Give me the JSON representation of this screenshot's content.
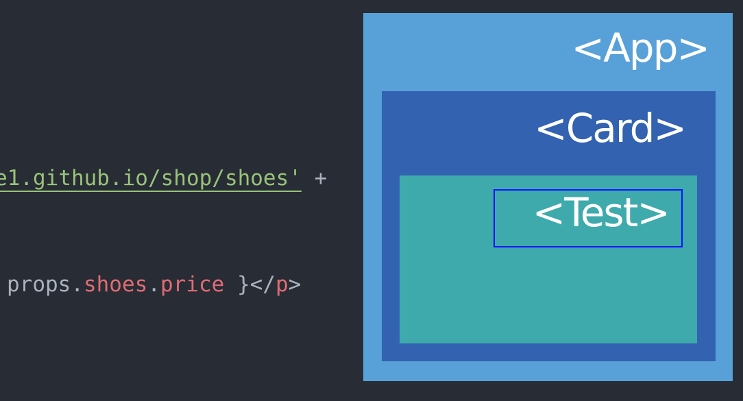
{
  "code": {
    "line1": {
      "string": "e1.github.io/shop/shoes'",
      "operator": " +"
    },
    "line2": {
      "prefix": "props.",
      "prop_shoes": "shoes",
      "dot": ".",
      "prop_price": "price",
      "close_brace": " }",
      "tag_open": "</",
      "tag_name": "p",
      "tag_close": ">"
    }
  },
  "diagram": {
    "app_label": "<App>",
    "card_label": "<Card>",
    "test_label": "<Test>"
  },
  "colors": {
    "background": "#282c34",
    "string": "#98c379",
    "property": "#e06c75",
    "app": "#57a0d8",
    "card": "#3262b0",
    "test": "#3eaaac",
    "highlight": "#0a14ff"
  }
}
